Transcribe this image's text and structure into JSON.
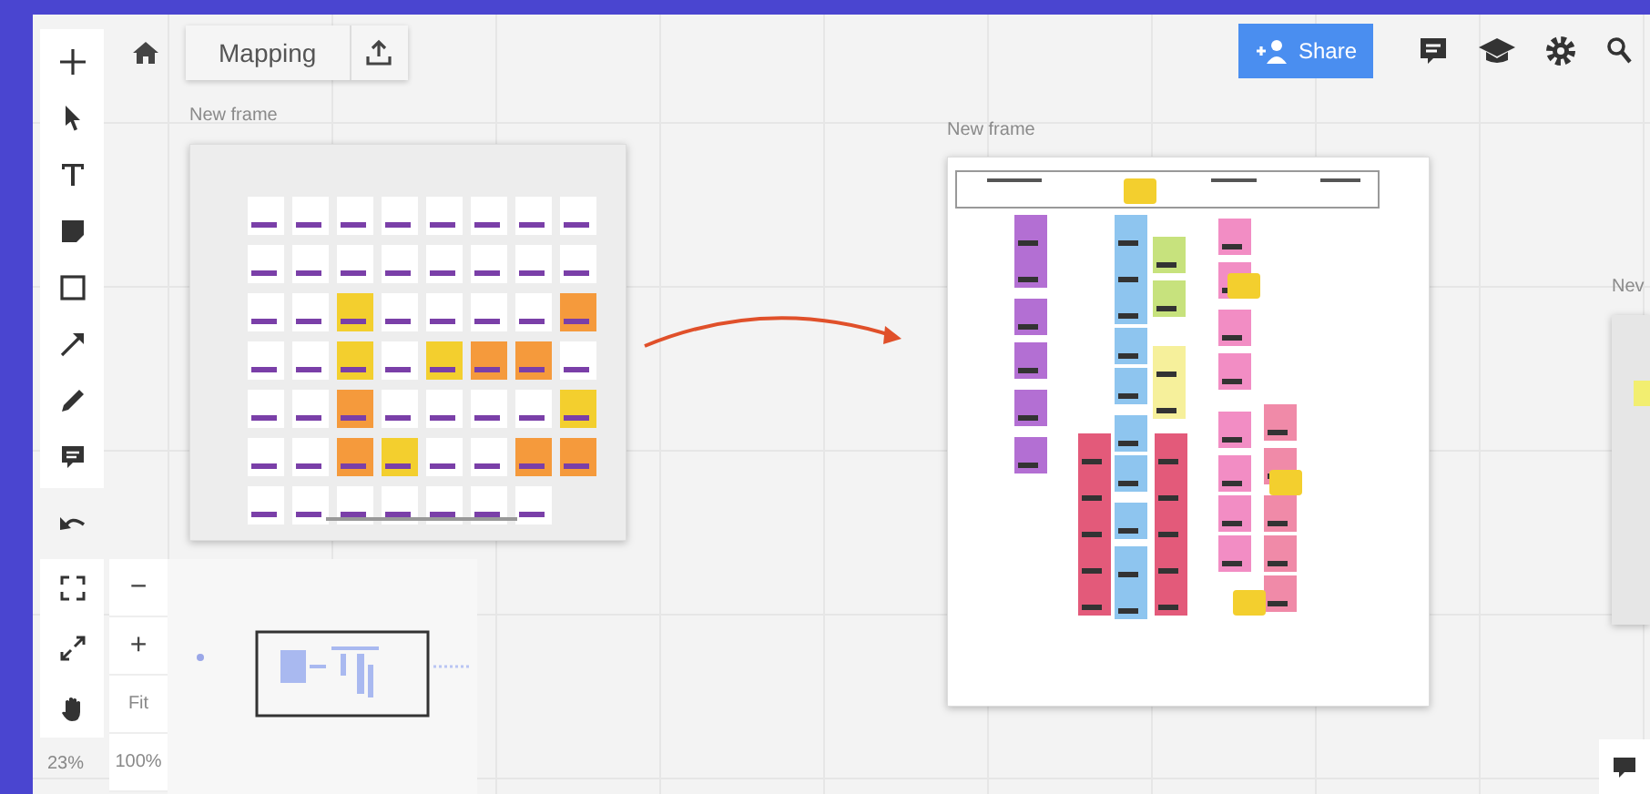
{
  "board": {
    "title": "Mapping"
  },
  "share": {
    "label": "Share"
  },
  "frames": [
    {
      "label": "New frame"
    },
    {
      "label": "New frame"
    },
    {
      "label": "Nev"
    }
  ],
  "zoom_controls": [
    "−",
    "+",
    "Fit"
  ],
  "zoom_reset": "100%",
  "zoom_level": "23%"
}
